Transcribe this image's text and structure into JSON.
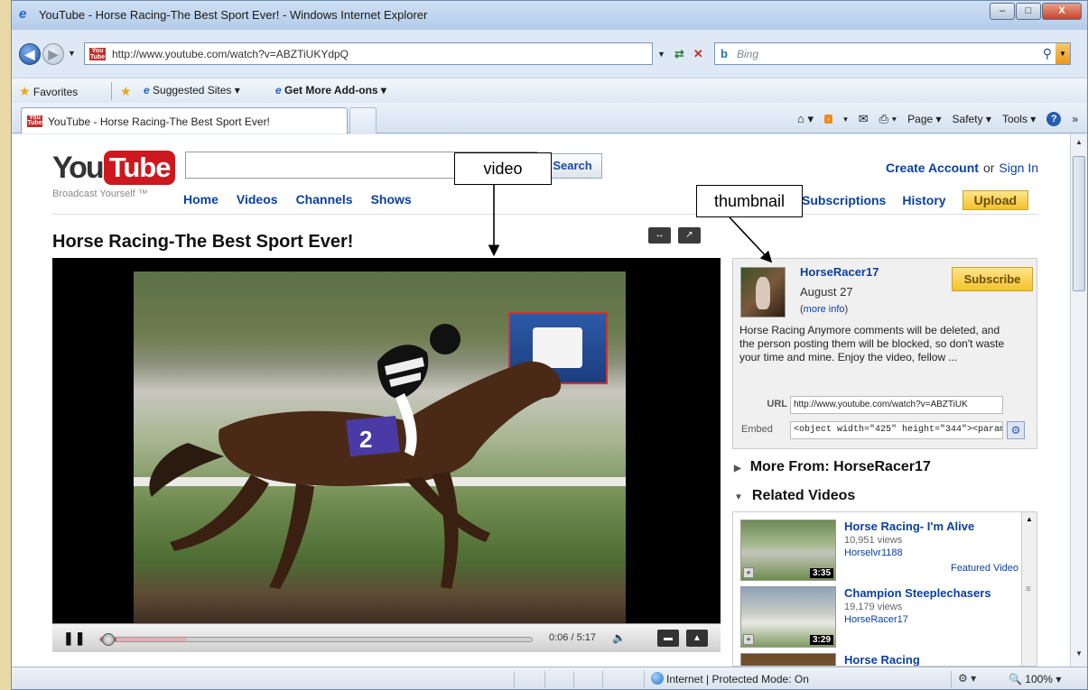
{
  "window": {
    "title": "YouTube - Horse Racing-The Best Sport Ever! - Windows Internet Explorer",
    "minimize": "–",
    "maximize": "□",
    "close": "X"
  },
  "address_bar": {
    "url": "http://www.youtube.com/watch?v=ABZTiUKYdpQ",
    "search_placeholder": "Bing"
  },
  "favorites_bar": {
    "favorites": "Favorites",
    "suggested_sites": "Suggested Sites ▾",
    "get_addons": "Get More Add-ons ▾"
  },
  "tab": {
    "title": "YouTube - Horse Racing-The Best Sport Ever!"
  },
  "command_bar": {
    "page": "Page ▾",
    "safety": "Safety ▾",
    "tools": "Tools ▾",
    "more": "»"
  },
  "youtube": {
    "logo_you": "You",
    "logo_tube": "Tube",
    "tagline": "Broadcast Yourself ™",
    "search_button": "Search",
    "nav": [
      "Home",
      "Videos",
      "Channels",
      "Shows"
    ],
    "create_account": "Create Account",
    "or": "or",
    "sign_in": "Sign In",
    "subscriptions": "Subscriptions",
    "history": "History",
    "upload": "Upload"
  },
  "video": {
    "title": "Horse Racing-The Best Sport Ever!",
    "time": "0:06 / 5:17",
    "progress_fraction": 0.019
  },
  "channel": {
    "uploader": "HorseRacer17",
    "date": "August 27",
    "more_info": "more info",
    "subscribe": "Subscribe",
    "description": "Horse Racing Anymore comments will be deleted, and the person posting them will be blocked, so don't waste your time and mine. Enjoy the video, fellow ...",
    "url_label": "URL",
    "url_value": "http://www.youtube.com/watch?v=ABZTiUK",
    "embed_label": "Embed",
    "embed_value": "<object width=\"425\" height=\"344\"><param"
  },
  "sections": {
    "more_from": "More From: HorseRacer17",
    "related": "Related Videos"
  },
  "related_videos": [
    {
      "title": "Horse Racing- I'm Alive",
      "views": "10,951 views",
      "user": "Horselvr1188",
      "duration": "3:35",
      "featured": "Featured Video"
    },
    {
      "title": "Champion Steeplechasers",
      "views": "19,179 views",
      "user": "HorseRacer17",
      "duration": "3:29",
      "featured": ""
    },
    {
      "title": "Horse Racing",
      "views": "",
      "user": "",
      "duration": "",
      "featured": ""
    }
  ],
  "annotations": {
    "video": "video",
    "thumbnail": "thumbnail"
  },
  "status_bar": {
    "zone": "Internet | Protected Mode: On",
    "zoom": "100%"
  }
}
